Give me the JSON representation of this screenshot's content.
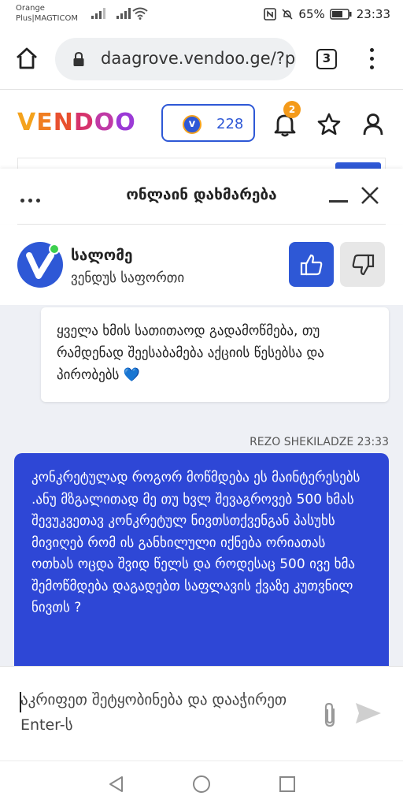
{
  "status_bar": {
    "carrier_line1": "Orange",
    "carrier_line2": "Plus|MAGTICOM",
    "battery": "65%",
    "time": "23:33"
  },
  "browser": {
    "url": "daagrove.vendoo.ge/?p",
    "tab_count": "3"
  },
  "site": {
    "logo_letters": [
      "V",
      "E",
      "N",
      "D",
      "O",
      "O"
    ],
    "logo_colors": [
      "#f4a21d",
      "#f07e22",
      "#e8502f",
      "#d6336c",
      "#c03aa6",
      "#9b3ad6"
    ],
    "coin_symbol": "v",
    "coins": "228",
    "notifications": "2",
    "accent": "#2e58d6"
  },
  "chat": {
    "title": "ონლაინ დახმარება",
    "agent_name": "სალომე",
    "agent_role": "ვენდუს საფორთი",
    "incoming_message": "ყველა ხმის სათითაოდ გადამოწმება, თუ რამდენად შეესაბამება აქციის წესებსა და პირობებს 💙",
    "outgoing_meta": "REZO SHEKILADZE 23:33",
    "outgoing_message": "კონკრეტულად როგორ მოწმდება ეს მაინტერესებს .ანუ მზგალითად მე თუ ხვლ შევაგროვებ 500 ხმას შევუკვეთავ კონკრეტულ ნივთსთქვენგან პასუხს მივიღებ რომ ის განხილული იქნება ორიათას ოთხას ოცდა შვიდ წელს და როდესაც 500 ივე ხმა შემოწმდება დაგადებთ საფლავის ქვაზე კუთვნილ ნივთს ?",
    "composer_placeholder": "აკრიფეთ შეტყობინება და დააჭირეთ  Enter-ს"
  }
}
